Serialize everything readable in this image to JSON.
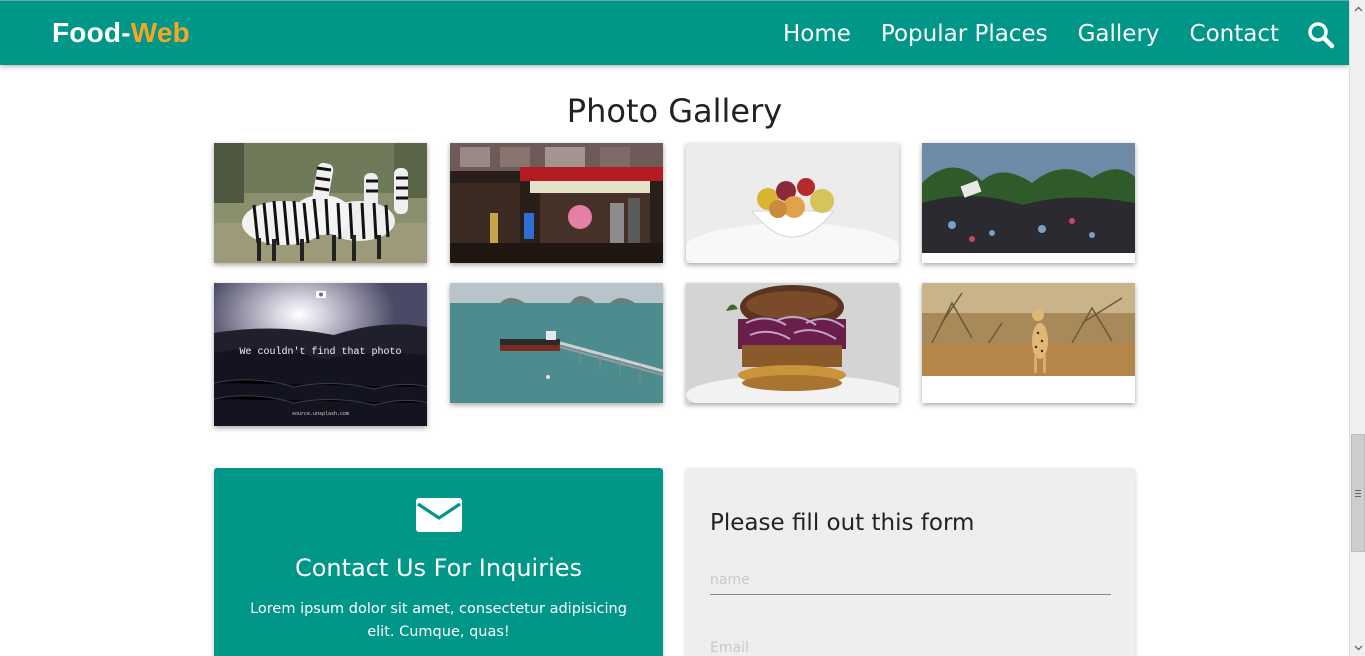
{
  "header": {
    "brand_main": "Food-",
    "brand_accent": "Web",
    "nav": [
      "Home",
      "Popular Places",
      "Gallery",
      "Contact"
    ],
    "search_icon": "search-icon"
  },
  "colors": {
    "primary": "#009688",
    "accent": "#f5a623",
    "form_bg": "#eeeeee"
  },
  "gallery": {
    "title": "Photo Gallery",
    "photos": [
      {
        "subject": "zebras",
        "name": "photo-zebras"
      },
      {
        "subject": "market street",
        "name": "photo-market"
      },
      {
        "subject": "fruit bowl",
        "name": "photo-fruit-bowl"
      },
      {
        "subject": "jungle debris",
        "name": "photo-jungle"
      },
      {
        "subject": "placeholder",
        "name": "photo-placeholder",
        "message": "We couldn't find that photo",
        "footer": "source.unsplash.com"
      },
      {
        "subject": "pier harbor",
        "name": "photo-pier"
      },
      {
        "subject": "burger",
        "name": "photo-burger"
      },
      {
        "subject": "cheetah",
        "name": "photo-cheetah"
      }
    ]
  },
  "contact": {
    "icon": "envelope-icon",
    "title": "Contact Us For Inquiries",
    "text": "Lorem ipsum dolor sit amet, consectetur adipisicing elit. Cumque, quas!"
  },
  "form": {
    "title": "Please fill out this form",
    "name_placeholder": "name",
    "email_placeholder": "Email"
  }
}
